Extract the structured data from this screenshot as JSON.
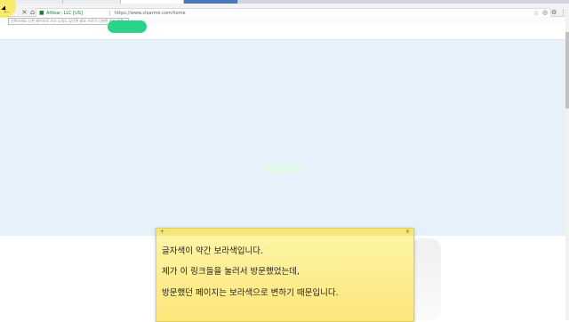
{
  "browser": {
    "site_identity": "Altlear, LLC [US]",
    "url": "https://www.clearme.com/home",
    "tooltip": "선택하세요 다른 페이지로 가고 쇼핑도 있으면 돼요 가로가 나쁘면 전부 해를"
  },
  "note": {
    "add_label": "+",
    "close_label": "×",
    "line1": "글자색이 약간 보라색입니다.",
    "line2": "제가 이 링크들을 눌러서 방문했었는데,",
    "line3": "방문했던 페이지는 보라색으로 변하기 때문입니다."
  },
  "colors": {
    "accent_green": "#2bd388",
    "hero_bg": "#e7f1fb",
    "note_yellow": "#fde67b"
  }
}
